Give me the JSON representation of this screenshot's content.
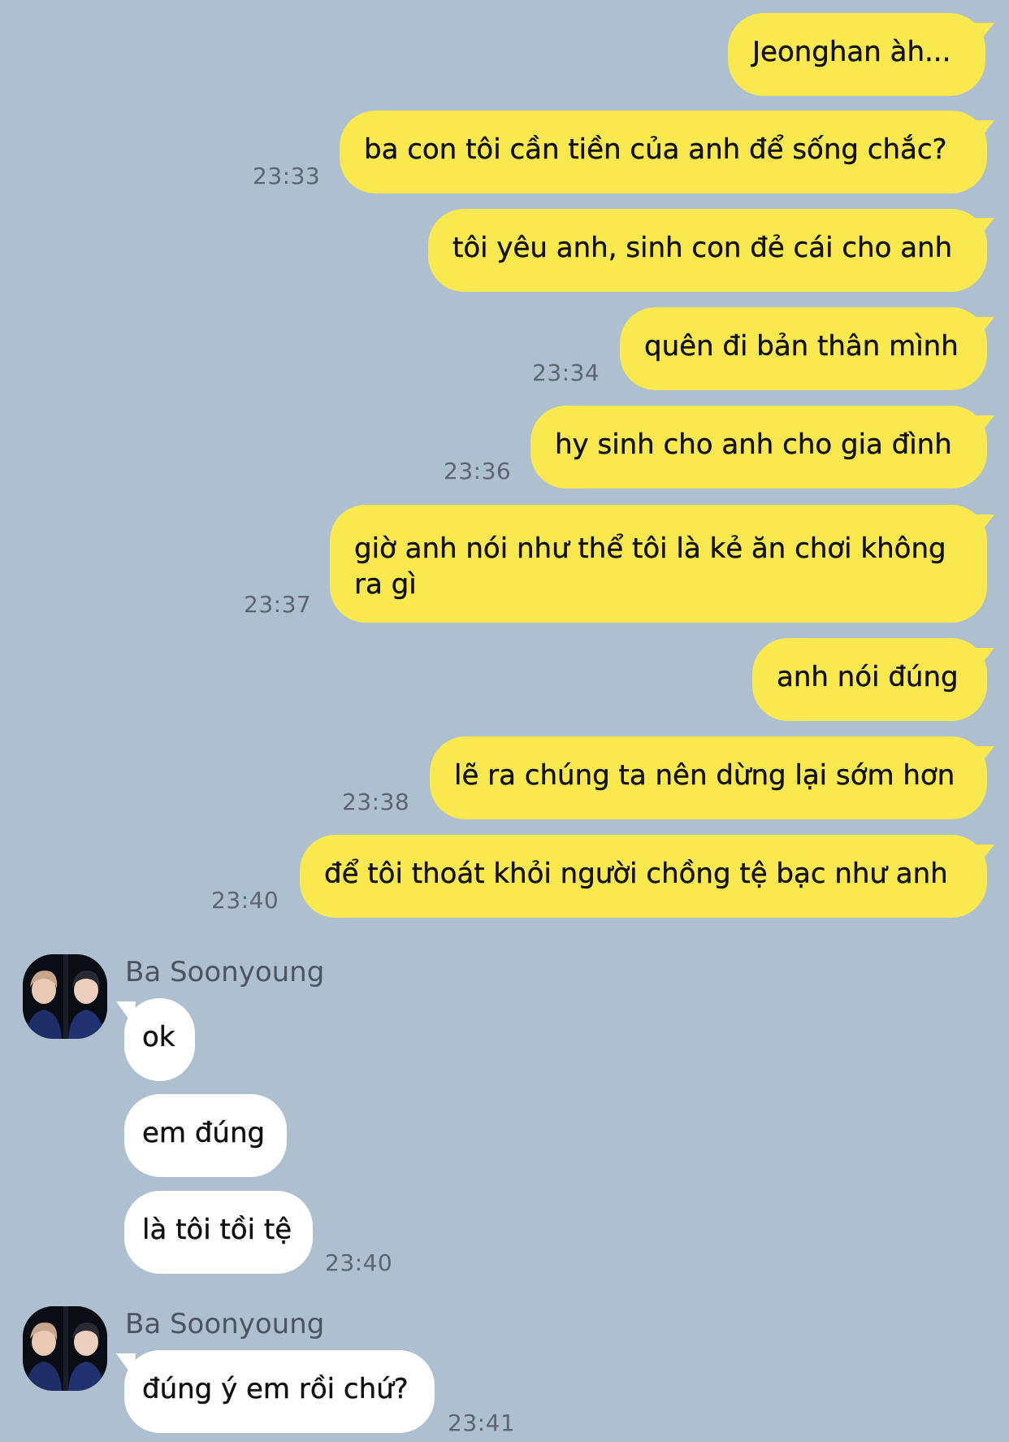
{
  "outgoing": [
    {
      "text": "Jeonghan àh...",
      "time": ""
    },
    {
      "text": "ba con tôi cần tiền của anh để sống chắc?",
      "time": "23:33"
    },
    {
      "text": "tôi yêu anh, sinh con đẻ cái cho anh",
      "time": ""
    },
    {
      "text": "quên đi bản thân mình",
      "time": "23:34"
    },
    {
      "text": "hy sinh cho anh cho gia đình",
      "time": "23:36"
    },
    {
      "text": "giờ anh nói như thể tôi là kẻ ăn chơi không ra gì",
      "time": "23:37"
    },
    {
      "text": "anh nói đúng",
      "time": ""
    },
    {
      "text": "lẽ ra chúng ta nên dừng lại sớm hơn",
      "time": "23:38"
    },
    {
      "text": "để tôi thoát khỏi người chồng tệ bạc như anh",
      "time": "23:40"
    }
  ],
  "incoming_groups": [
    {
      "sender": "Ba Soonyoung",
      "avatar_icon": "profile-photo",
      "messages": [
        {
          "text": "ok",
          "time": ""
        },
        {
          "text": "em đúng",
          "time": ""
        },
        {
          "text": "là tôi tồi tệ",
          "time": "23:40"
        }
      ]
    },
    {
      "sender": "Ba Soonyoung",
      "avatar_icon": "profile-photo",
      "messages": [
        {
          "text": "đúng ý em rồi chứ?",
          "time": "23:41"
        }
      ]
    }
  ],
  "colors": {
    "background": "#AEBFD0",
    "outgoing_bubble": "#FAE84F",
    "incoming_bubble": "#FFFFFF",
    "timestamp": "#5C6670"
  }
}
